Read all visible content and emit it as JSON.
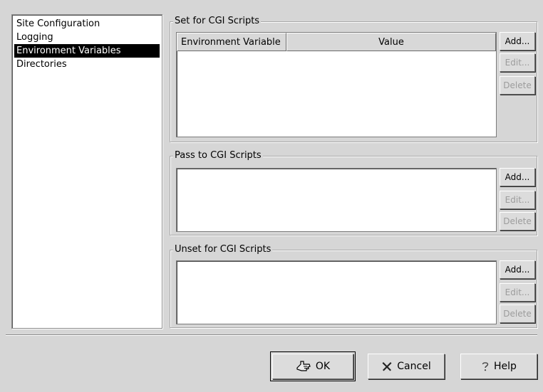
{
  "nav": {
    "items": [
      {
        "label": "Site Configuration",
        "selected": false
      },
      {
        "label": "Logging",
        "selected": false
      },
      {
        "label": "Environment Variables",
        "selected": true
      },
      {
        "label": "Directories",
        "selected": false
      }
    ]
  },
  "set_group": {
    "title": "Set for CGI Scripts",
    "columns": [
      "Environment Variable",
      "Value"
    ],
    "add_label": "Add...",
    "edit_label": "Edit...",
    "delete_label": "Delete"
  },
  "pass_group": {
    "title": "Pass to CGI Scripts",
    "add_label": "Add...",
    "edit_label": "Edit...",
    "delete_label": "Delete"
  },
  "unset_group": {
    "title": "Unset for CGI Scripts",
    "add_label": "Add...",
    "edit_label": "Edit...",
    "delete_label": "Delete"
  },
  "dialog": {
    "ok_label": "OK",
    "cancel_label": "Cancel",
    "help_label": "Help"
  },
  "icons": {
    "ok": "hand-pointer-icon",
    "cancel": "x-cancel-icon",
    "help": "question-icon"
  },
  "colors": {
    "window_bg": "#d6d6d6",
    "selection_bg": "#000000",
    "disabled_text": "#9c9c9c"
  }
}
